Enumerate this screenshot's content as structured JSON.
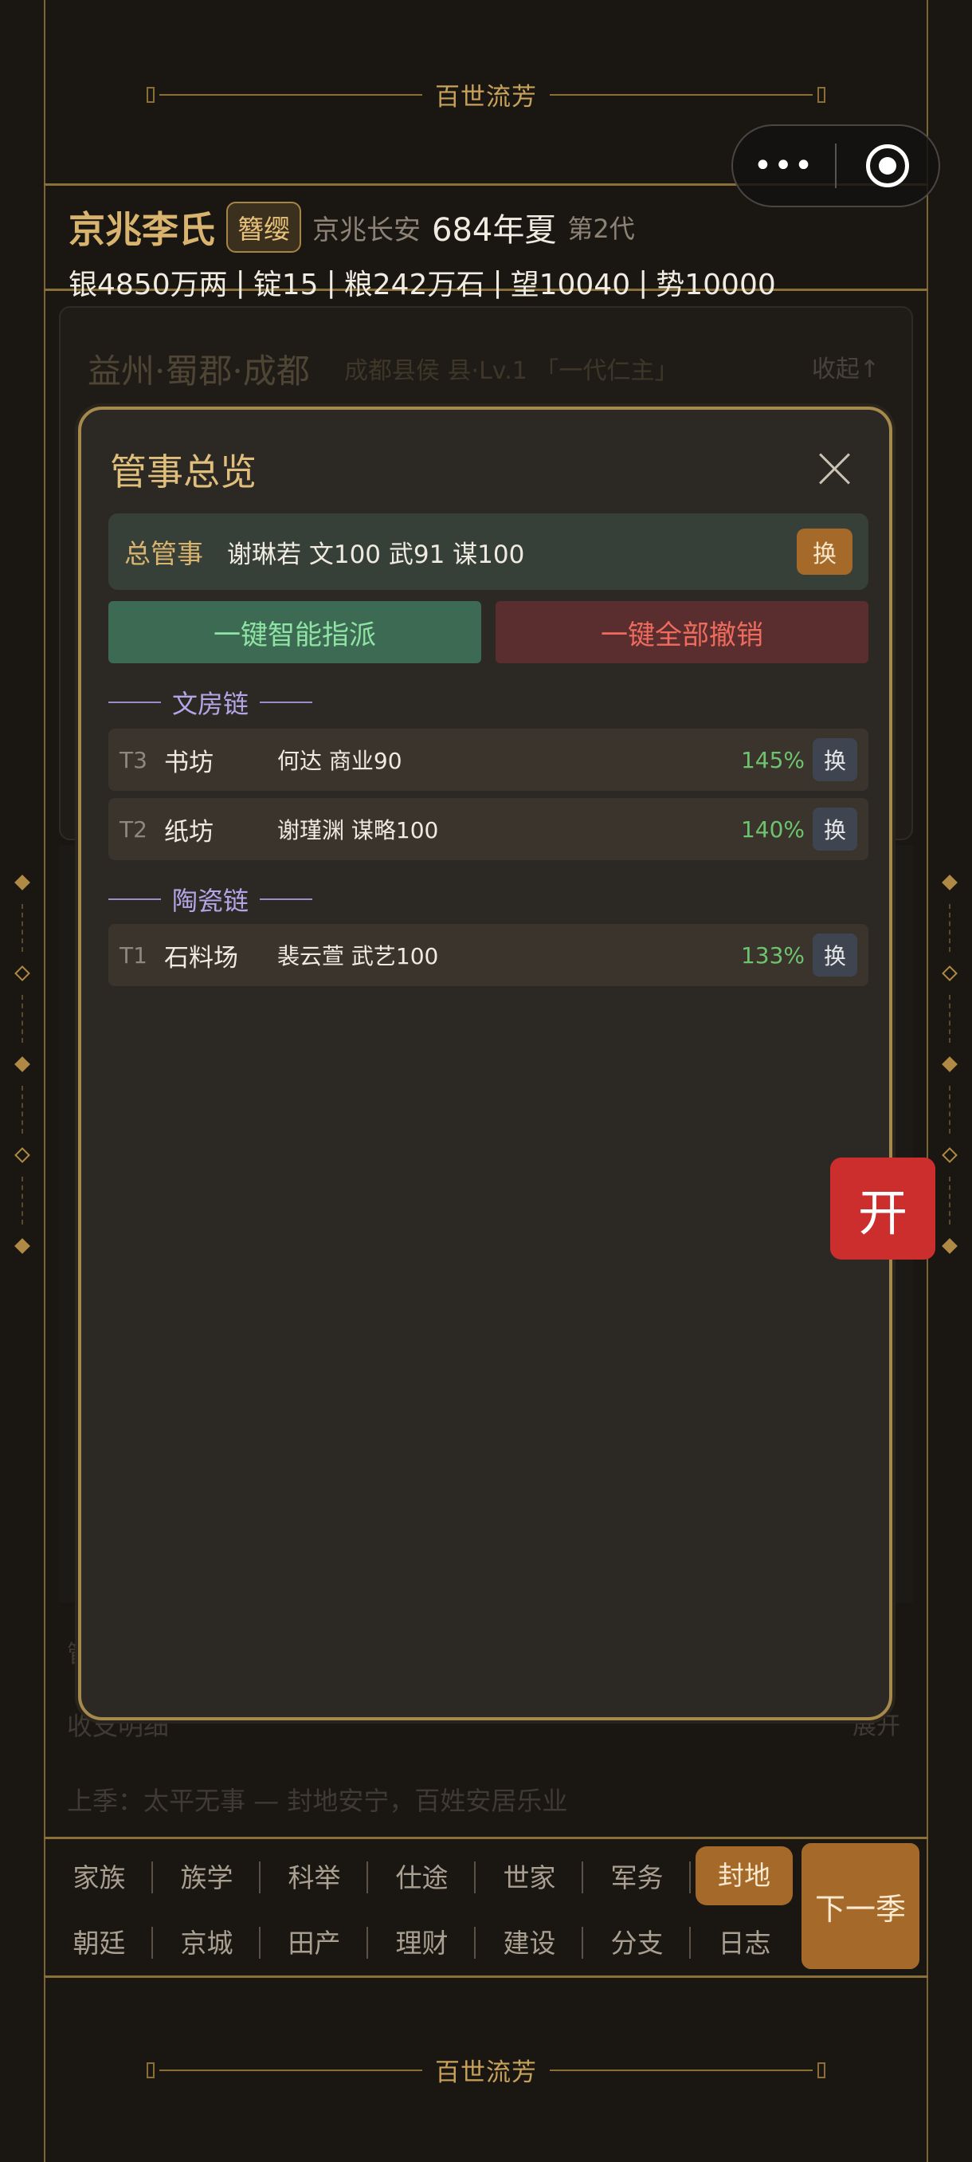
{
  "banner": {
    "title": "百世流芳"
  },
  "header": {
    "clan_name": "京兆李氏",
    "rank_badge": "簪缨",
    "location": "京兆长安",
    "year": "684年夏",
    "generation": "第2代",
    "stats": [
      "银4850万两",
      "锭15",
      "粮242万石",
      "望10040",
      "势10000"
    ],
    "stat_divider": "|"
  },
  "background_panel": {
    "title": "益州·蜀郡·成都",
    "subtitle": "成都县侯  县·Lv.1 「一代仁主」",
    "collapse_label": "收起↑"
  },
  "background_footer": {
    "line1": "管",
    "line2": "收支明细",
    "line3": "上季：太平无事 — 封地安宁，百姓安居乐业",
    "expand": "展开"
  },
  "modal": {
    "title": "管事总览",
    "chief": {
      "label": "总管事",
      "value": "谢琳若 文100 武91 谋100",
      "swap": "换"
    },
    "auto_assign": "一键智能指派",
    "revoke_all": "一键全部撤销",
    "chains": [
      {
        "name": "文房链",
        "workshops": [
          {
            "tier": "T3",
            "name": "书坊",
            "manager": "何达 商业90",
            "pct": "145%",
            "swap": "换"
          },
          {
            "tier": "T2",
            "name": "纸坊",
            "manager": "谢瑾渊 谋略100",
            "pct": "140%",
            "swap": "换"
          }
        ]
      },
      {
        "name": "陶瓷链",
        "workshops": [
          {
            "tier": "T1",
            "name": "石料场",
            "manager": "裴云萱 武艺100",
            "pct": "133%",
            "swap": "换"
          }
        ]
      }
    ]
  },
  "open_button": "开",
  "nav": {
    "row1": [
      "家族",
      "族学",
      "科举",
      "仕途",
      "世家",
      "军务",
      "封地"
    ],
    "row2": [
      "朝廷",
      "京城",
      "田产",
      "理财",
      "建设",
      "分支",
      "日志"
    ],
    "active": "封地",
    "next": "下一季"
  },
  "colors": {
    "gold": "#d9b46e",
    "accent_brown": "#a5692a",
    "red": "#cc2e2e",
    "green": "#6ec46e"
  }
}
